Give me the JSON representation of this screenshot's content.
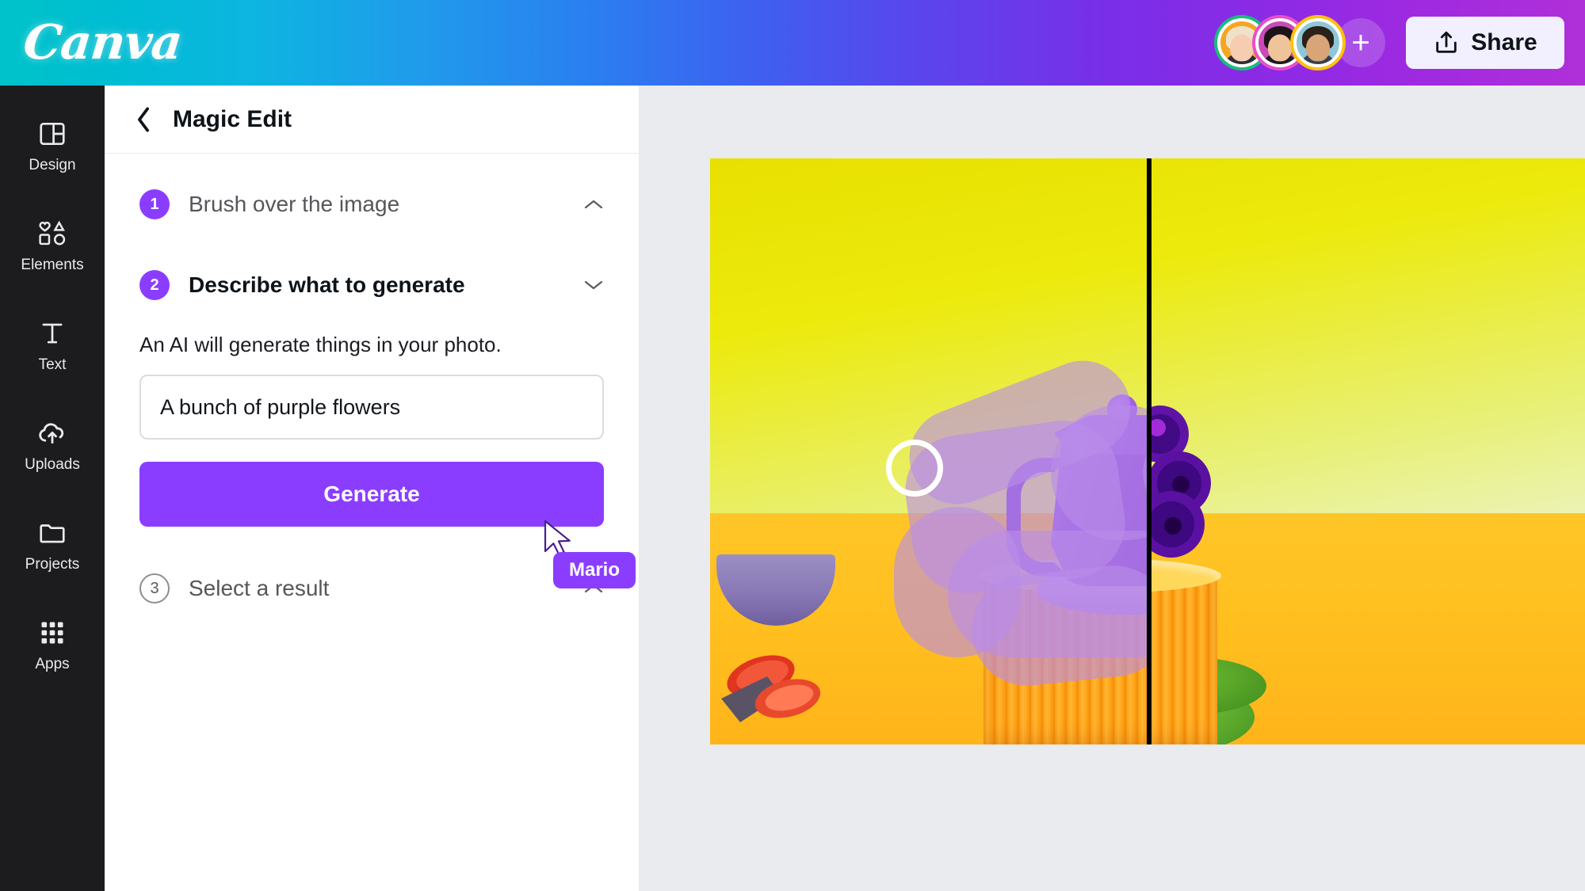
{
  "app": {
    "brand": "Canva",
    "logo_name": "canva-logo"
  },
  "topbar": {
    "collaborators": [
      {
        "name": "collaborator-1",
        "ring": "#1abc7b",
        "bg": "#f5a623",
        "hair": "#f0e2c8",
        "skin": "#f6cdb0",
        "body": "#2c2c3a"
      },
      {
        "name": "collaborator-2",
        "ring": "#e84ecb",
        "bg": "#c94ab8",
        "hair": "#1d1418",
        "skin": "#f0c49a",
        "body": "#1b1b24"
      },
      {
        "name": "collaborator-3",
        "ring": "#ffc10e",
        "bg": "#8fc6d8",
        "hair": "#2a2118",
        "skin": "#d9a478",
        "body": "#37404e"
      }
    ],
    "add_collaborator_label": "+",
    "share_label": "Share",
    "share_icon": "upload-icon"
  },
  "sidebar": {
    "items": [
      {
        "label": "Design",
        "icon": "design-layout-icon"
      },
      {
        "label": "Elements",
        "icon": "shapes-icon"
      },
      {
        "label": "Text",
        "icon": "text-t-icon"
      },
      {
        "label": "Uploads",
        "icon": "cloud-upload-icon"
      },
      {
        "label": "Projects",
        "icon": "folder-icon"
      },
      {
        "label": "Apps",
        "icon": "grid-apps-icon"
      }
    ]
  },
  "panel": {
    "back_icon": "chevron-left-icon",
    "title": "Magic Edit",
    "steps": [
      {
        "number": "1",
        "label": "Brush over the image",
        "state": "done",
        "chevron": "chevron-up-icon"
      },
      {
        "number": "2",
        "label": "Describe what to generate",
        "state": "active",
        "chevron": "chevron-down-icon"
      },
      {
        "number": "3",
        "label": "Select a result",
        "state": "inactive",
        "chevron": "chevron-up-icon"
      }
    ],
    "describe": {
      "help_text": "An AI will generate things in your photo.",
      "prompt_value": "A bunch of purple flowers",
      "prompt_placeholder": "Describe what to generate",
      "generate_label": "Generate"
    }
  },
  "cursor": {
    "pointer_icon": "mouse-pointer-icon",
    "user_name": "Mario"
  },
  "canvas": {
    "background": "#e9ebee",
    "brush_cursor_icon": "brush-circle-cursor",
    "compare_divider": "#000000",
    "left_pane_name": "original-with-brush-mask",
    "right_pane_name": "generated-result-preview",
    "image_description_left": "Purple teapot on orange ribbed pedestal with brush mask",
    "image_description_right": "Purple flowers in orange ribbed pot"
  },
  "colors": {
    "accent_purple": "#8b3dff",
    "brand_teal": "#00c3c9",
    "panel_bg": "#ffffff",
    "rail_bg": "#1c1c1e"
  }
}
